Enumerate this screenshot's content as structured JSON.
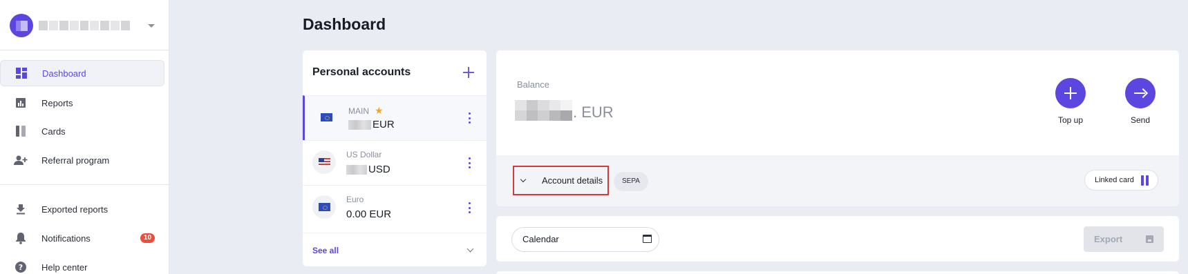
{
  "sidebar": {
    "nav": [
      {
        "label": "Dashboard",
        "icon": "dashboard-icon",
        "active": true
      },
      {
        "label": "Reports",
        "icon": "reports-icon"
      },
      {
        "label": "Cards",
        "icon": "cards-icon"
      },
      {
        "label": "Referral program",
        "icon": "add-user-icon"
      }
    ],
    "nav2": [
      {
        "label": "Exported reports",
        "icon": "download-icon"
      },
      {
        "label": "Notifications",
        "icon": "bell-icon",
        "badge": "10"
      },
      {
        "label": "Help center",
        "icon": "help-icon"
      }
    ]
  },
  "page": {
    "title": "Dashboard"
  },
  "accounts": {
    "title": "Personal accounts",
    "items": [
      {
        "name": "MAIN",
        "currency": "EUR",
        "amount": "",
        "flag": "eu",
        "favorite": true,
        "selected": true
      },
      {
        "name": "US Dollar",
        "currency": "USD",
        "amount": "",
        "flag": "us"
      },
      {
        "name": "Euro",
        "currency": "",
        "amount": "0.00 EUR",
        "flag": "eu"
      }
    ],
    "see_all": "See all"
  },
  "balance": {
    "label": "Balance",
    "currency": ". EUR",
    "top_up": "Top up",
    "send": "Send",
    "account_details": "Account details",
    "sepa": "SEPA",
    "linked_card": "Linked card"
  },
  "filters": {
    "calendar": "Calendar",
    "export": "Export"
  },
  "colors": {
    "accent": "#5b47e0",
    "badge": "#f04c3e",
    "highlight": "#d43a3a"
  }
}
